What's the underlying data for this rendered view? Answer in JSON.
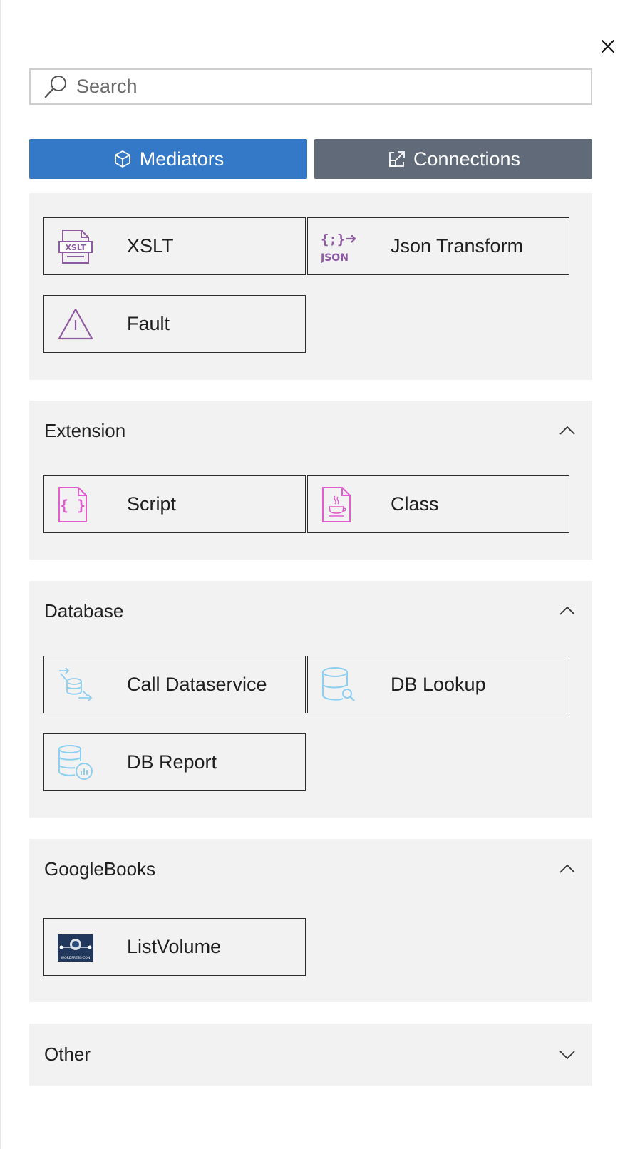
{
  "search": {
    "placeholder": "Search",
    "value": ""
  },
  "tabs": [
    {
      "label": "Mediators",
      "active": true,
      "icon": "cube-icon"
    },
    {
      "label": "Connections",
      "active": false,
      "icon": "external-link-icon"
    }
  ],
  "colors": {
    "active_tab": "#3478c8",
    "inactive_tab": "#606a78",
    "panel_bg": "#f2f2f2",
    "purple_icon": "#8e5aa2",
    "pink_icon": "#e25bd0",
    "blue_icon": "#8dcff0"
  },
  "top_panel": {
    "items": [
      {
        "label": "XSLT",
        "icon": "xslt-file-icon"
      },
      {
        "label": "Json Transform",
        "icon": "json-transform-icon"
      },
      {
        "label": "Fault",
        "icon": "warning-triangle-icon"
      }
    ]
  },
  "sections": [
    {
      "title": "Extension",
      "expanded": true,
      "items": [
        {
          "label": "Script",
          "icon": "script-file-icon"
        },
        {
          "label": "Class",
          "icon": "java-file-icon"
        }
      ]
    },
    {
      "title": "Database",
      "expanded": true,
      "items": [
        {
          "label": "Call Dataservice",
          "icon": "call-dataservice-icon"
        },
        {
          "label": "DB Lookup",
          "icon": "db-lookup-icon"
        },
        {
          "label": "DB Report",
          "icon": "db-report-icon"
        }
      ]
    },
    {
      "title": "GoogleBooks",
      "expanded": true,
      "items": [
        {
          "label": "ListVolume",
          "icon": "wordpress-connector-icon",
          "logo_text": "WORDPRESS-CON"
        }
      ]
    },
    {
      "title": "Other",
      "expanded": false,
      "items": []
    }
  ]
}
